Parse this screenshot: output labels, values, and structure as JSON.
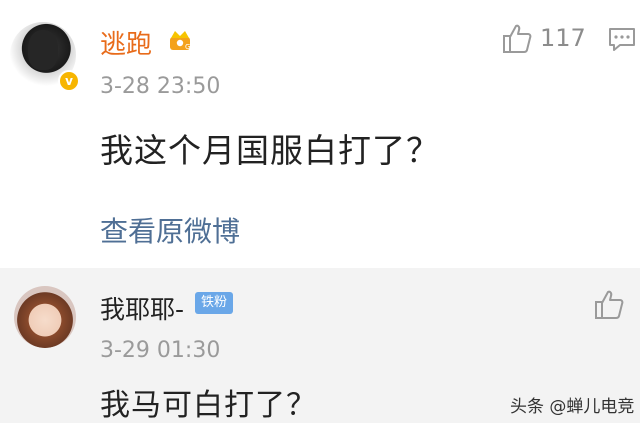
{
  "comment1": {
    "username": "逃跑",
    "avatar_badge": "v",
    "time": "3-28 23:50",
    "text": "我这个月国服白打了？",
    "like_count": "117",
    "view_original": "查看原微博",
    "icons": [
      "crown-icon",
      "thumbs-up-icon",
      "reply-icon"
    ],
    "username_color": "#e86b1a"
  },
  "comment2": {
    "username": "我耶耶-",
    "fan_badge": "铁粉",
    "time": "3-29 01:30",
    "text": "我马可白打了？",
    "icons": [
      "thumbs-up-icon"
    ]
  },
  "watermark": "头条 @蝉儿电竞",
  "colors": {
    "link": "#4f6f95",
    "badge_blue": "#6aa7e8",
    "verified_gold": "#f7b500"
  }
}
